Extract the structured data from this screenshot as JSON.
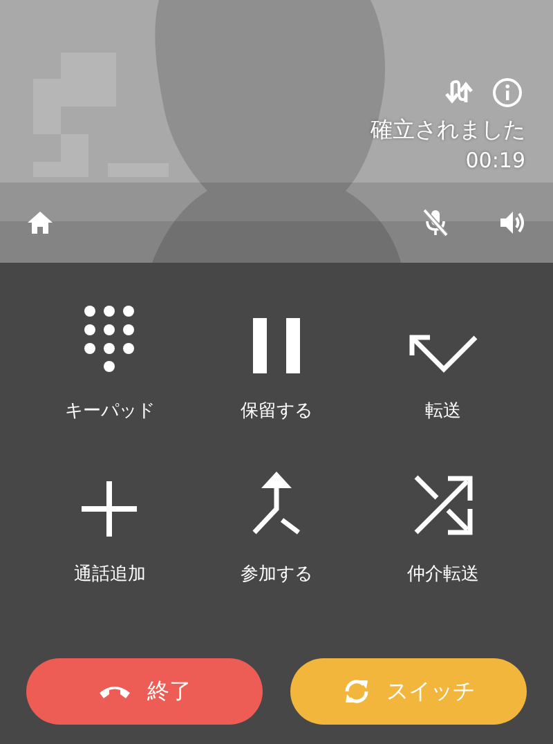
{
  "call": {
    "status": "確立されました",
    "timer": "00:19"
  },
  "actions": [
    {
      "kind": "keypad",
      "label": "キーパッド"
    },
    {
      "kind": "hold",
      "label": "保留する"
    },
    {
      "kind": "transfer",
      "label": "転送"
    },
    {
      "kind": "add",
      "label": "通話追加"
    },
    {
      "kind": "merge",
      "label": "参加する"
    },
    {
      "kind": "swap",
      "label": "仲介転送"
    }
  ],
  "buttons": [
    {
      "kind": "end",
      "label": "終了"
    },
    {
      "kind": "switch",
      "label": "スイッチ"
    }
  ]
}
